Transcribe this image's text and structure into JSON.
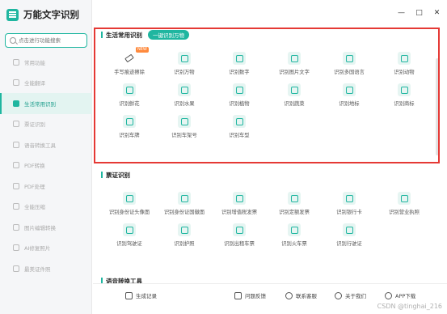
{
  "app": {
    "title": "万能文字识别"
  },
  "search": {
    "placeholder": "点击进行功能搜索"
  },
  "sidebar": {
    "items": [
      {
        "label": "常用功能",
        "active": false
      },
      {
        "label": "全能翻译",
        "active": false
      },
      {
        "label": "生活常用识别",
        "active": true
      },
      {
        "label": "票证识别",
        "active": false
      },
      {
        "label": "语音转换工具",
        "active": false
      },
      {
        "label": "PDF转换",
        "active": false
      },
      {
        "label": "PDF处理",
        "active": false
      },
      {
        "label": "全能压缩",
        "active": false
      },
      {
        "label": "图片编辑转换",
        "active": false
      },
      {
        "label": "AI修复照片",
        "active": false
      },
      {
        "label": "最美证件照",
        "active": false
      }
    ]
  },
  "window": {
    "minimize": "—",
    "maximize": "□",
    "close": "✕"
  },
  "sections": {
    "life": {
      "title": "生活常用识别",
      "tag": "一键识别万物",
      "tools": [
        {
          "label": "手写痕迹擦除",
          "icon": "eraser-icon",
          "badge": "NEW"
        },
        {
          "label": "识别万物",
          "icon": "eye-icon"
        },
        {
          "label": "识别数字",
          "icon": "digits-icon"
        },
        {
          "label": "识别图片文字",
          "icon": "image-text-icon"
        },
        {
          "label": "识别多国语言",
          "icon": "language-icon"
        },
        {
          "label": "识别动物",
          "icon": "animal-icon"
        },
        {
          "label": "识别鲜花",
          "icon": "flower-icon"
        },
        {
          "label": "识别水果",
          "icon": "fruit-icon"
        },
        {
          "label": "识别植物",
          "icon": "plant-icon"
        },
        {
          "label": "识别蔬菜",
          "icon": "vegetable-icon"
        },
        {
          "label": "识别地标",
          "icon": "landmark-icon"
        },
        {
          "label": "识别商标",
          "icon": "trademark-icon"
        },
        {
          "label": "识别车牌",
          "icon": "license-plate-icon"
        },
        {
          "label": "识别车架号",
          "icon": "vin-icon"
        },
        {
          "label": "识别车型",
          "icon": "car-model-icon"
        }
      ]
    },
    "ticket": {
      "title": "票证识别",
      "tools": [
        {
          "label": "识别身份证头像面",
          "icon": "id-front-icon"
        },
        {
          "label": "识别身份证国徽面",
          "icon": "id-back-icon"
        },
        {
          "label": "识别增值税发票",
          "icon": "vat-invoice-icon"
        },
        {
          "label": "识别定额发票",
          "icon": "quota-invoice-icon"
        },
        {
          "label": "识别银行卡",
          "icon": "bank-card-icon"
        },
        {
          "label": "识别营业执照",
          "icon": "business-license-icon"
        },
        {
          "label": "识别驾驶证",
          "icon": "driver-license-icon"
        },
        {
          "label": "识别护照",
          "icon": "passport-icon"
        },
        {
          "label": "识别出租车票",
          "icon": "taxi-ticket-icon"
        },
        {
          "label": "识别火车票",
          "icon": "train-ticket-icon"
        },
        {
          "label": "识别行驶证",
          "icon": "vehicle-license-icon"
        }
      ]
    },
    "next": {
      "title": "语音转换工具"
    }
  },
  "bottom": {
    "history": "生成记录",
    "feedback": "问题反馈",
    "service": "联系客服",
    "about": "关于我们",
    "app": "APP下载"
  },
  "watermark": "CSDN @tinghai_216",
  "colors": {
    "accent": "#1fb6a0",
    "highlight": "#e53935",
    "badge": "#ff8a3d"
  }
}
